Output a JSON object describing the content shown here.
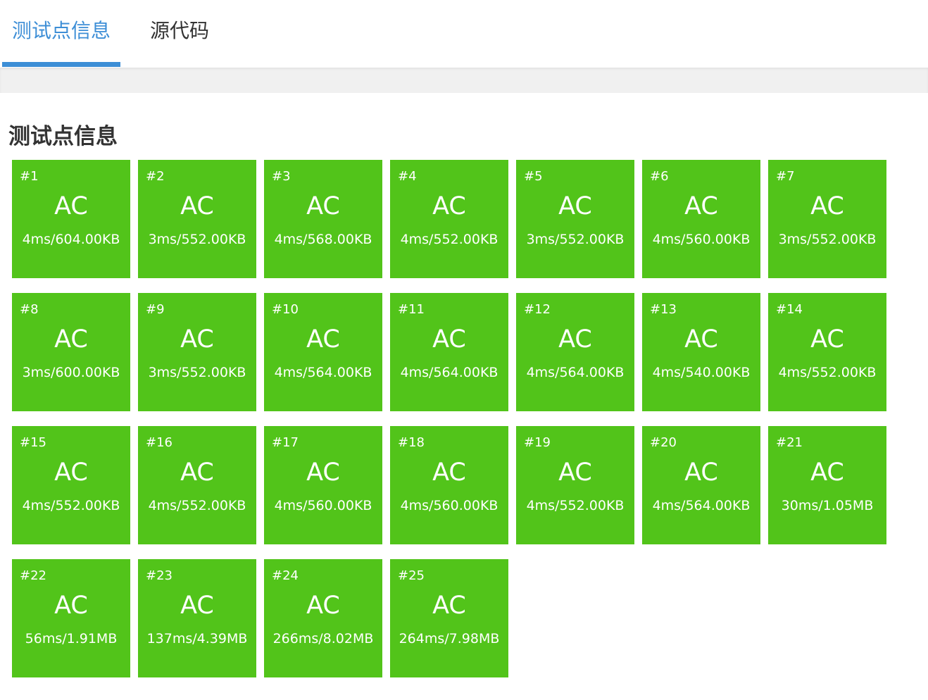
{
  "tabs": [
    {
      "label": "测试点信息",
      "active": true
    },
    {
      "label": "源代码",
      "active": false
    }
  ],
  "section_title": "测试点信息",
  "colors": {
    "accent": "#3d8ed6",
    "ac_tile": "#52c41a"
  },
  "testcases": [
    {
      "id": "#1",
      "status": "AC",
      "stats": "4ms/604.00KB"
    },
    {
      "id": "#2",
      "status": "AC",
      "stats": "3ms/552.00KB"
    },
    {
      "id": "#3",
      "status": "AC",
      "stats": "4ms/568.00KB"
    },
    {
      "id": "#4",
      "status": "AC",
      "stats": "4ms/552.00KB"
    },
    {
      "id": "#5",
      "status": "AC",
      "stats": "3ms/552.00KB"
    },
    {
      "id": "#6",
      "status": "AC",
      "stats": "4ms/560.00KB"
    },
    {
      "id": "#7",
      "status": "AC",
      "stats": "3ms/552.00KB"
    },
    {
      "id": "#8",
      "status": "AC",
      "stats": "3ms/600.00KB"
    },
    {
      "id": "#9",
      "status": "AC",
      "stats": "3ms/552.00KB"
    },
    {
      "id": "#10",
      "status": "AC",
      "stats": "4ms/564.00KB"
    },
    {
      "id": "#11",
      "status": "AC",
      "stats": "4ms/564.00KB"
    },
    {
      "id": "#12",
      "status": "AC",
      "stats": "4ms/564.00KB"
    },
    {
      "id": "#13",
      "status": "AC",
      "stats": "4ms/540.00KB"
    },
    {
      "id": "#14",
      "status": "AC",
      "stats": "4ms/552.00KB"
    },
    {
      "id": "#15",
      "status": "AC",
      "stats": "4ms/552.00KB"
    },
    {
      "id": "#16",
      "status": "AC",
      "stats": "4ms/552.00KB"
    },
    {
      "id": "#17",
      "status": "AC",
      "stats": "4ms/560.00KB"
    },
    {
      "id": "#18",
      "status": "AC",
      "stats": "4ms/560.00KB"
    },
    {
      "id": "#19",
      "status": "AC",
      "stats": "4ms/552.00KB"
    },
    {
      "id": "#20",
      "status": "AC",
      "stats": "4ms/564.00KB"
    },
    {
      "id": "#21",
      "status": "AC",
      "stats": "30ms/1.05MB"
    },
    {
      "id": "#22",
      "status": "AC",
      "stats": "56ms/1.91MB"
    },
    {
      "id": "#23",
      "status": "AC",
      "stats": "137ms/4.39MB"
    },
    {
      "id": "#24",
      "status": "AC",
      "stats": "266ms/8.02MB"
    },
    {
      "id": "#25",
      "status": "AC",
      "stats": "264ms/7.98MB"
    }
  ]
}
